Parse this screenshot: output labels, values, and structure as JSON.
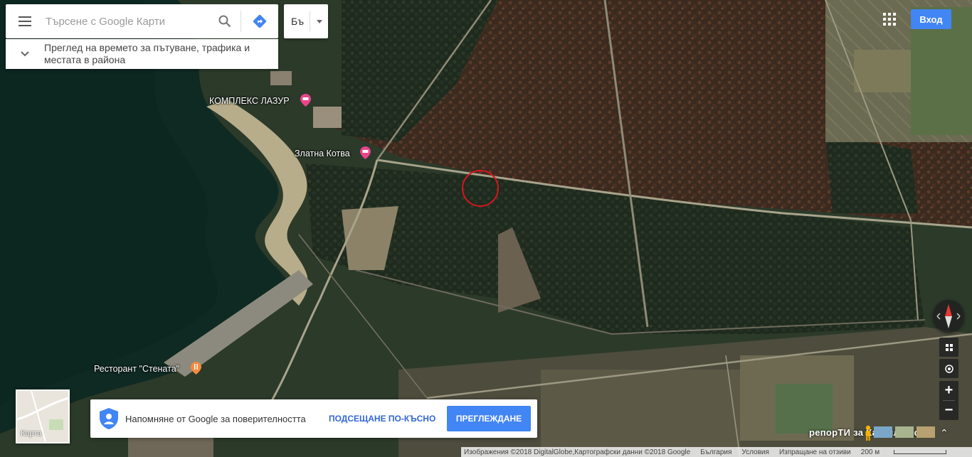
{
  "search": {
    "placeholder": "Търсене с Google Карти",
    "menu_icon": "hamburger-icon",
    "search_icon": "search-icon",
    "directions_icon": "directions-icon"
  },
  "language": {
    "label": "Бъ"
  },
  "infobar": {
    "text": "Преглед на времето за пътуване, трафика и местата в района"
  },
  "header": {
    "signin_label": "Вход",
    "apps_icon": "apps-grid-icon"
  },
  "places": [
    {
      "name": "КОМПЛЕКС ЛАЗУР",
      "type": "hotel"
    },
    {
      "name": "Златна Котва",
      "type": "hotel"
    },
    {
      "name": "Ресторант \"Стената\"",
      "type": "restaurant"
    }
  ],
  "minimap": {
    "label": "Карта"
  },
  "privacy": {
    "text": "Напомняне от Google за поверителността",
    "later_label": "ПОДСЕЩАНЕ ПО-КЪСНО",
    "review_label": "ПРЕГЛЕЖДАНЕ"
  },
  "watermark": "репорТИ за Казанлък.com",
  "footer": {
    "imagery": "Изображения ©2018 DigitalGlobe,Картографски данни ©2018 Google",
    "country": "България",
    "terms": "Условия",
    "feedback": "Изпращане на отзиви",
    "scale": "200 м"
  },
  "colors": {
    "accent": "#4285f4",
    "hotel_pin": "#e8458b",
    "restaurant_pin": "#f58a3d",
    "highlight_ring": "#d8151e"
  }
}
